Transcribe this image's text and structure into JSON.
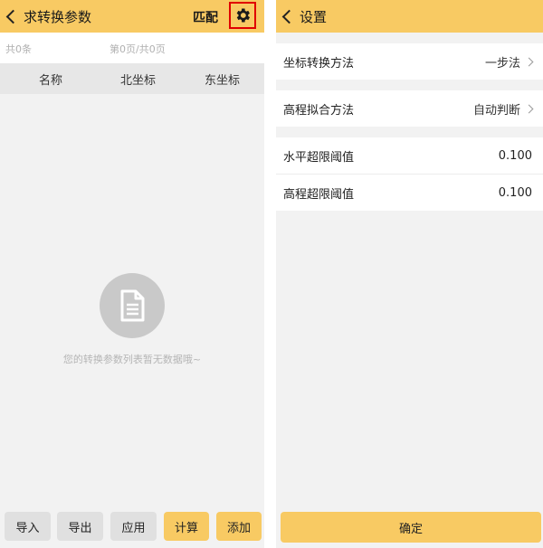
{
  "left": {
    "title": "求转换参数",
    "match_label": "匹配",
    "count_text": "共0条",
    "page_text": "第0页/共0页",
    "columns": [
      "名称",
      "北坐标",
      "东坐标"
    ],
    "empty_message": "您的转换参数列表暂无数据哦~",
    "footer_buttons": [
      "导入",
      "导出",
      "应用",
      "计算",
      "添加"
    ]
  },
  "right": {
    "title": "设置",
    "rows": [
      {
        "label": "坐标转换方法",
        "value": "一步法"
      },
      {
        "label": "高程拟合方法",
        "value": "自动判断"
      },
      {
        "label": "水平超限阈值",
        "value": "0.100"
      },
      {
        "label": "高程超限阈值",
        "value": "0.100"
      }
    ],
    "confirm_label": "确定"
  },
  "colors": {
    "accent": "#f8ca63",
    "highlight_box": "#e00000"
  },
  "icons": [
    "back-chevron-icon",
    "gear-icon",
    "document-icon",
    "chevron-right-icon"
  ]
}
